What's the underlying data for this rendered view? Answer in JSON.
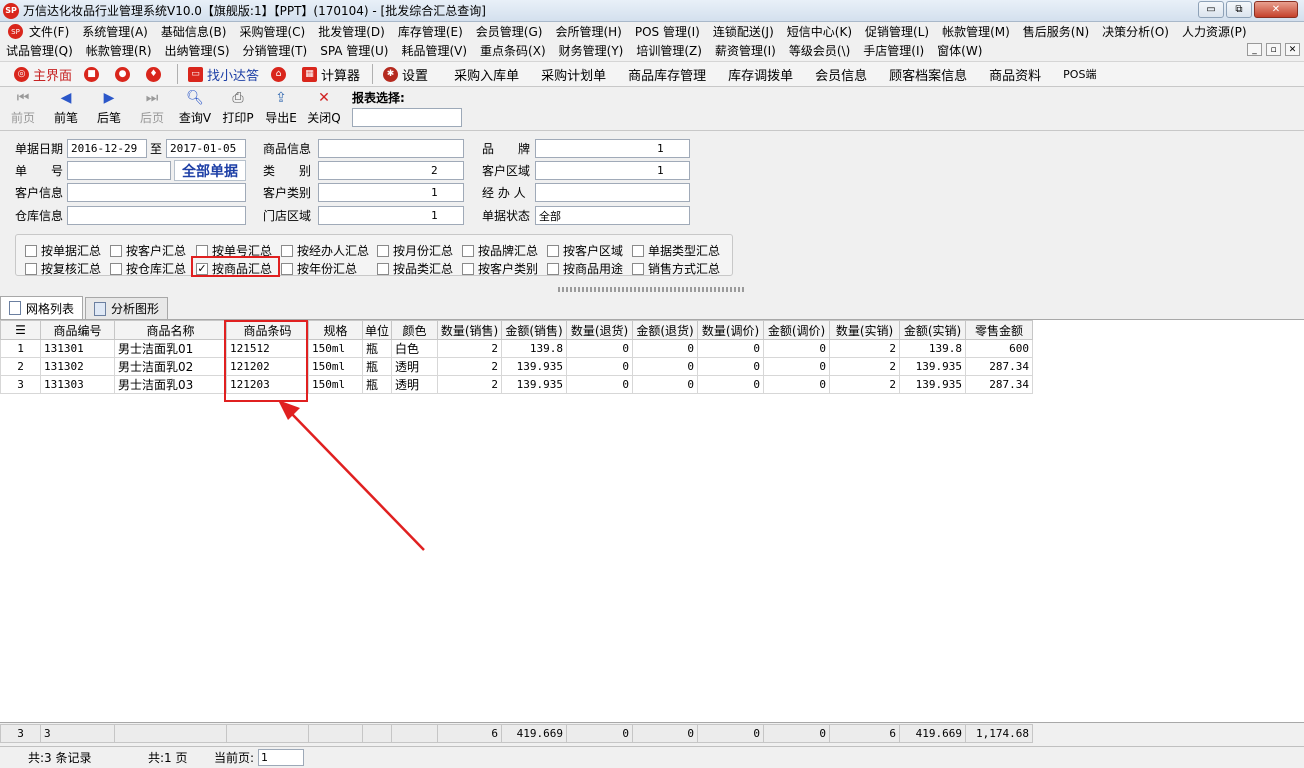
{
  "window": {
    "logo_text": "SP",
    "title": "万信达化妆品行业管理系统V10.0【旗舰版:1】【PPT】(170104) - [批发综合汇总查询]",
    "min": "▭",
    "restore": "⧉",
    "close": "✕"
  },
  "menu_row1": [
    "文件(F)",
    "系统管理(A)",
    "基础信息(B)",
    "采购管理(C)",
    "批发管理(D)",
    "库存管理(E)",
    "会员管理(G)",
    "会所管理(H)",
    "POS 管理(I)",
    "连锁配送(J)",
    "短信中心(K)",
    "促销管理(L)",
    "帐款管理(M)",
    "售后服务(N)",
    "决策分析(O)",
    "人力资源(P)"
  ],
  "menu_row2": [
    "试品管理(Q)",
    "帐款管理(R)",
    "出纳管理(S)",
    "分销管理(T)",
    "SPA 管理(U)",
    "耗品管理(V)",
    "重点条码(X)",
    "财务管理(Y)",
    "培训管理(Z)",
    "薪资管理(I)",
    "等级会员(\\)",
    "手店管理(I)",
    "窗体(W)"
  ],
  "mdi_buttons": [
    "_",
    "▫",
    "✕"
  ],
  "quickbar": {
    "main": "主界面",
    "find": "找小达答",
    "calc": "计算器",
    "settings": "设置",
    "links": [
      "采购入库单",
      "采购计划单",
      "商品库存管理",
      "库存调拨单",
      "会员信息",
      "顾客档案信息",
      "商品资料",
      "POS端"
    ]
  },
  "toolbar": {
    "prev_page": "前页",
    "prev_rec": "前笔",
    "next_rec": "后笔",
    "next_page": "后页",
    "query": "查询V",
    "print": "打印P",
    "export": "导出E",
    "close": "关闭Q",
    "report_select": "报表选择:",
    "report_value": ""
  },
  "filter": {
    "date_label": "单据日期",
    "date_from": "2016-12-29",
    "to": "至",
    "date_to": "2017-01-05",
    "doc_label": "单　　号",
    "doc_value": "",
    "all_docs": "全部单据",
    "customer_label": "客户信息",
    "customer_value": "",
    "warehouse_label": "仓库信息",
    "warehouse_value": "",
    "goods_label": "商品信息",
    "goods_value": "",
    "category_label": "类　　别",
    "category_value": "2",
    "cust_type_label": "客户类别",
    "cust_type_value": "1",
    "store_area_label": "门店区域",
    "store_area_value": "1",
    "brand_label": "品　　牌",
    "brand_value": "1",
    "cust_area_label": "客户区域",
    "cust_area_value": "1",
    "handler_label": "经 办 人",
    "handler_value": "",
    "status_label": "单据状态",
    "status_value": "全部"
  },
  "checkboxes": [
    {
      "label": "按单据汇总",
      "checked": false
    },
    {
      "label": "按客户汇总",
      "checked": false
    },
    {
      "label": "按单号汇总",
      "checked": false
    },
    {
      "label": "按经办人汇总",
      "checked": false
    },
    {
      "label": "按月份汇总",
      "checked": false
    },
    {
      "label": "按品牌汇总",
      "checked": false
    },
    {
      "label": "按客户区域",
      "checked": false
    },
    {
      "label": "单据类型汇总",
      "checked": false
    },
    {
      "label": "按复核汇总",
      "checked": false
    },
    {
      "label": "按仓库汇总",
      "checked": false
    },
    {
      "label": "按商品汇总",
      "checked": true
    },
    {
      "label": "按年份汇总",
      "checked": false
    },
    {
      "label": "按品类汇总",
      "checked": false
    },
    {
      "label": "按客户类别",
      "checked": false
    },
    {
      "label": "按商品用途",
      "checked": false
    },
    {
      "label": "销售方式汇总",
      "checked": false
    }
  ],
  "tabs": [
    "网格列表",
    "分析图形"
  ],
  "table": {
    "columns": [
      "",
      "商品编号",
      "商品名称",
      "商品条码",
      "规格",
      "单位",
      "颜色",
      "数量(销售)",
      "金额(销售)",
      "数量(退货)",
      "金额(退货)",
      "数量(调价)",
      "金额(调价)",
      "数量(实销)",
      "金额(实销)",
      "零售金额"
    ],
    "rows": [
      [
        "1",
        "131301",
        "男士洁面乳01",
        "121512",
        "150ml",
        "瓶",
        "白色",
        "2",
        "139.8",
        "0",
        "0",
        "0",
        "0",
        "2",
        "139.8",
        "600"
      ],
      [
        "2",
        "131302",
        "男士洁面乳02",
        "121202",
        "150ml",
        "瓶",
        "透明",
        "2",
        "139.935",
        "0",
        "0",
        "0",
        "0",
        "2",
        "139.935",
        "287.34"
      ],
      [
        "3",
        "131303",
        "男士洁面乳03",
        "121203",
        "150ml",
        "瓶",
        "透明",
        "2",
        "139.935",
        "0",
        "0",
        "0",
        "0",
        "2",
        "139.935",
        "287.34"
      ]
    ],
    "footer": [
      "3",
      "3",
      "",
      "",
      "",
      "",
      "",
      "6",
      "419.669",
      "0",
      "0",
      "0",
      "0",
      "6",
      "419.669",
      "1,174.68"
    ]
  },
  "status": {
    "records": "共:3 条记录",
    "pages": "共:1 页",
    "current_label": "当前页:",
    "current_value": "1"
  },
  "colors": {
    "highlight": "#e02020",
    "accent_red": "#d9261c",
    "all_docs_blue": "#1d3fa6"
  }
}
